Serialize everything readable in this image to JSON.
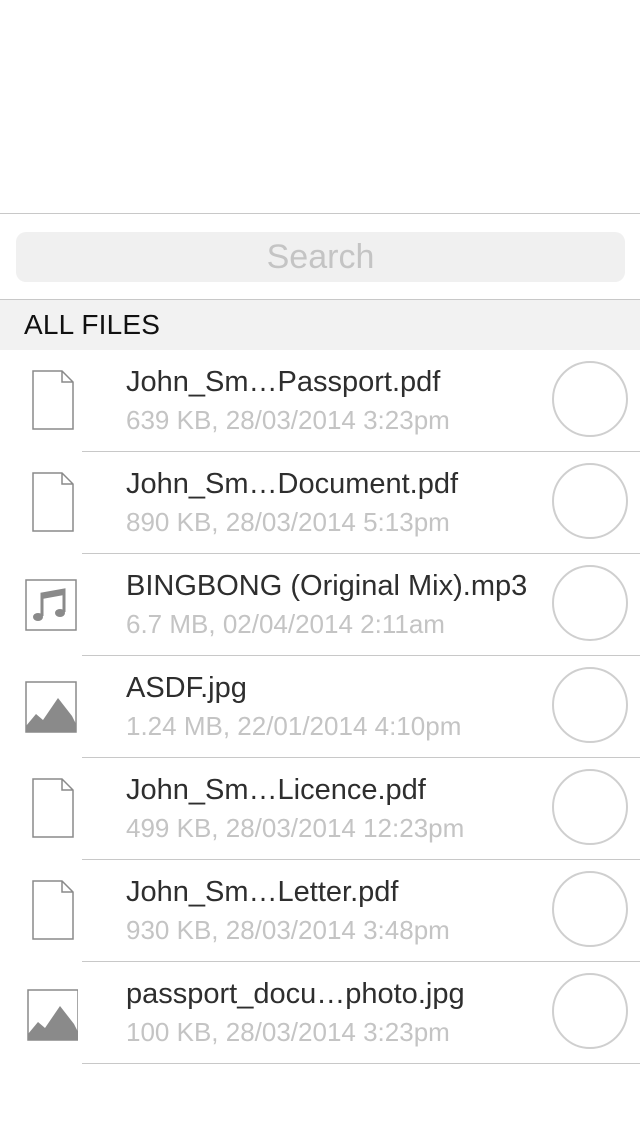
{
  "search": {
    "placeholder": "Search"
  },
  "section": {
    "title": "ALL FILES"
  },
  "files": [
    {
      "name": "John_Sm…Passport.pdf",
      "meta": "639 KB, 28/03/2014 3:23pm",
      "icon": "document-icon"
    },
    {
      "name": "John_Sm…Document.pdf",
      "meta": "890 KB, 28/03/2014 5:13pm",
      "icon": "document-icon"
    },
    {
      "name": "BINGBONG (Original Mix).mp3",
      "meta": "6.7 MB, 02/04/2014 2:11am",
      "icon": "music-icon"
    },
    {
      "name": "ASDF.jpg",
      "meta": "1.24 MB, 22/01/2014 4:10pm",
      "icon": "image-icon"
    },
    {
      "name": "John_Sm…Licence.pdf",
      "meta": "499 KB, 28/03/2014 12:23pm",
      "icon": "document-icon"
    },
    {
      "name": "John_Sm…Letter.pdf",
      "meta": "930 KB, 28/03/2014 3:48pm",
      "icon": "document-icon"
    },
    {
      "name": "passport_docu…photo.jpg",
      "meta": "100 KB, 28/03/2014 3:23pm",
      "icon": "image-icon"
    }
  ],
  "colors": {
    "icon_stroke": "#8a8a8a",
    "icon_fill": "#8a8a8a",
    "secondary_text": "#c4c4c4",
    "divider": "#c8c8c8"
  }
}
